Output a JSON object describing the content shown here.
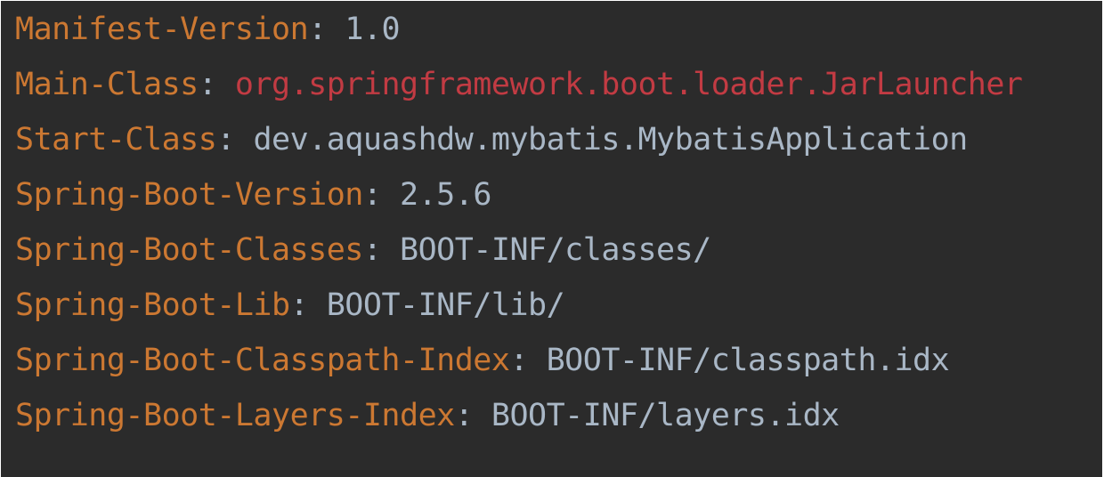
{
  "manifest": {
    "separator": ": ",
    "entries": [
      {
        "key": "Manifest-Version",
        "value": "1.0"
      },
      {
        "key": "Main-Class",
        "value": "org.springframework.boot.loader.JarLauncher"
      },
      {
        "key": "Start-Class",
        "value": "dev.aquashdw.mybatis.MybatisApplication"
      },
      {
        "key": "Spring-Boot-Version",
        "value": "2.5.6"
      },
      {
        "key": "Spring-Boot-Classes",
        "value": "BOOT-INF/classes/"
      },
      {
        "key": "Spring-Boot-Lib",
        "value": "BOOT-INF/lib/"
      },
      {
        "key": "Spring-Boot-Classpath-Index",
        "value": "BOOT-INF/classpath.idx"
      },
      {
        "key": "Spring-Boot-Layers-Index",
        "value": "BOOT-INF/layers.idx"
      }
    ]
  },
  "colors": {
    "background": "#2b2b2b",
    "key": "#cc7832",
    "value": "#a9b7c6",
    "highlighted_value": "#c23b43"
  }
}
